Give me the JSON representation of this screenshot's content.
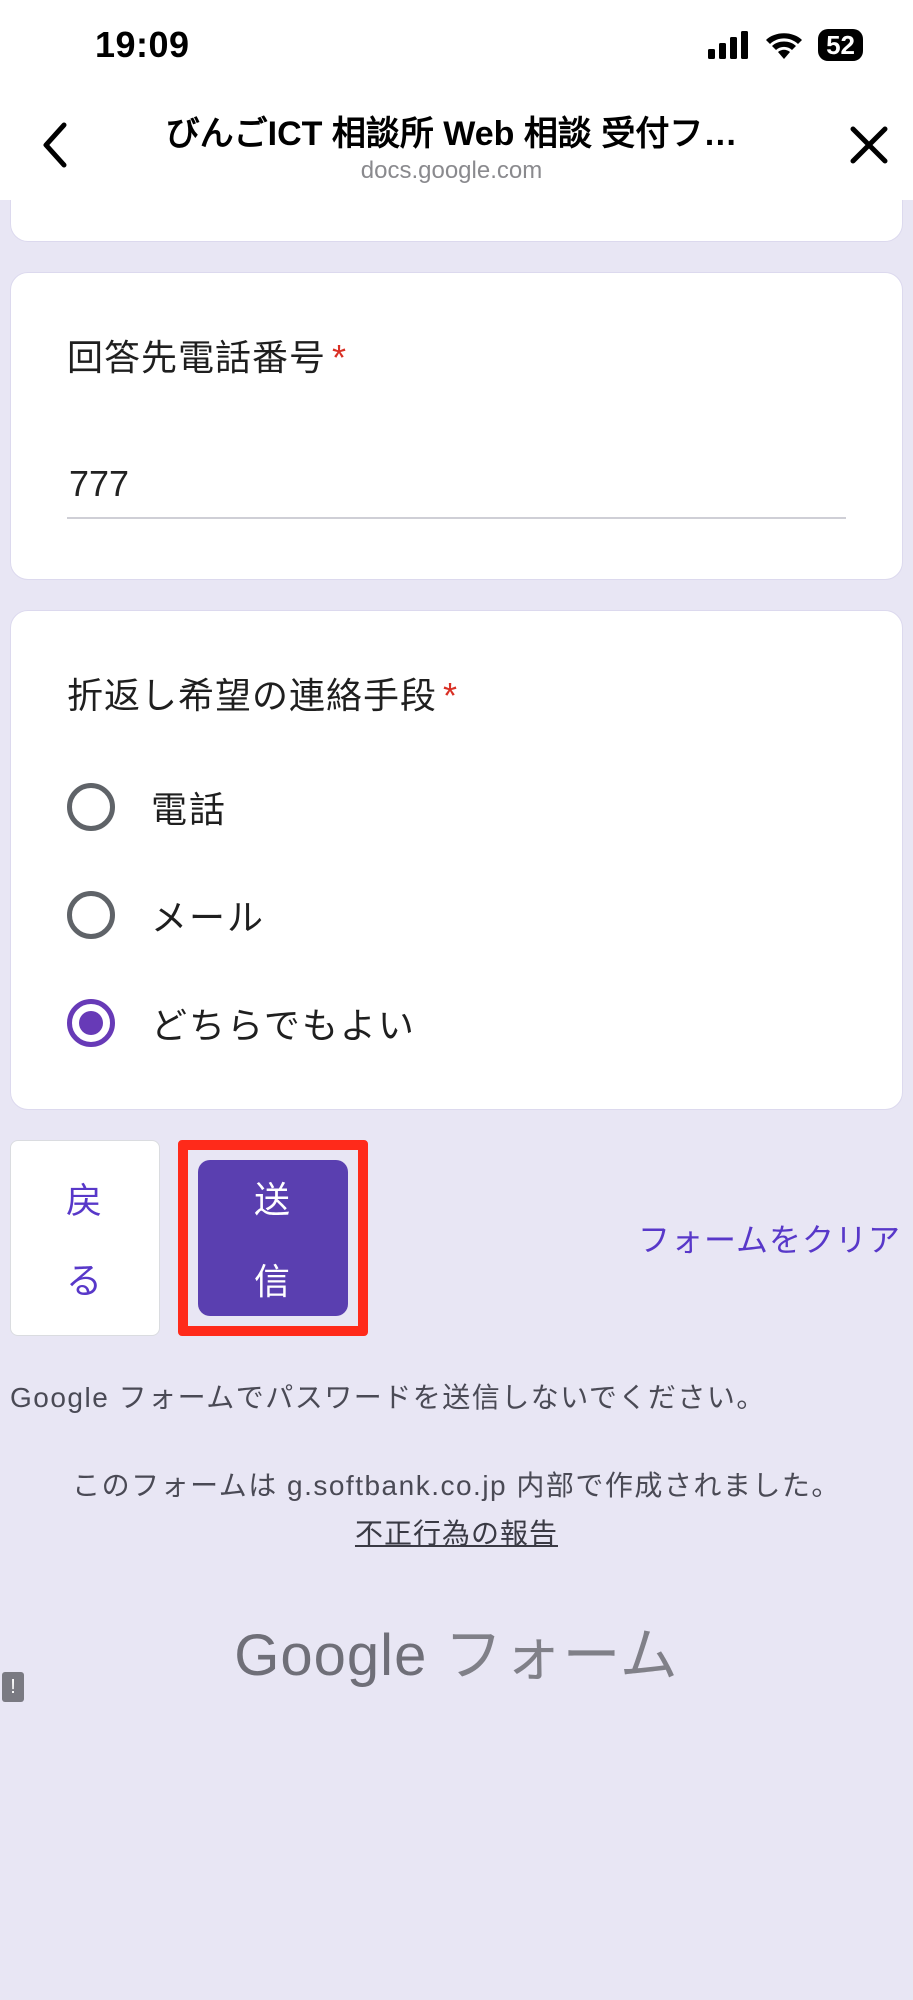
{
  "status": {
    "time": "19:09",
    "battery": "52"
  },
  "nav": {
    "title": "びんごICT 相談所 Web 相談 受付フ…",
    "subtitle": "docs.google.com"
  },
  "phone_card": {
    "title": "回答先電話番号",
    "value": "777"
  },
  "contact_card": {
    "title": "折返し希望の連絡手段",
    "options": [
      {
        "label": "電話",
        "selected": false
      },
      {
        "label": "メール",
        "selected": false
      },
      {
        "label": "どちらでもよい",
        "selected": true
      }
    ]
  },
  "actions": {
    "back": "戻る",
    "submit": "送信",
    "clear": "フォームをクリア"
  },
  "footer": {
    "warning": "Google フォームでパスワードを送信しないでください。",
    "origin": "このフォームは g.softbank.co.jp 内部で作成されました。",
    "abuse": "不正行為の報告",
    "brand_google": "Google",
    "brand_forms": " フォーム"
  }
}
